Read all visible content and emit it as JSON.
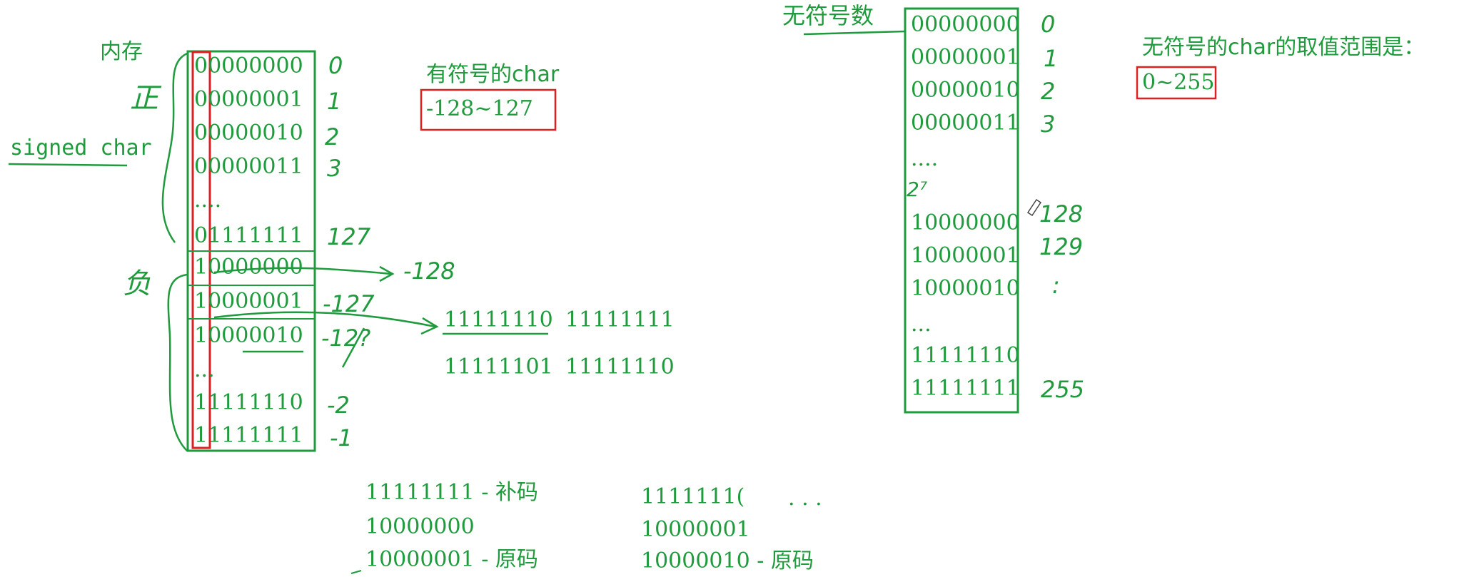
{
  "left_panel": {
    "memory_label": "内存",
    "signed_char_label": "signed char",
    "positive_mark": "正",
    "negative_mark": "负",
    "rows": [
      {
        "bits": "00000000",
        "value": "0"
      },
      {
        "bits": "00000001",
        "value": "1"
      },
      {
        "bits": "00000010",
        "value": "2"
      },
      {
        "bits": "00000011",
        "value": "3"
      },
      {
        "bits": "....",
        "value": ""
      },
      {
        "bits": "01111111",
        "value": "127"
      },
      {
        "bits": "10000000",
        "value": "-128"
      },
      {
        "bits": "10000001",
        "value": "-127"
      },
      {
        "bits": "10000010",
        "value": "-12?"
      },
      {
        "bits": "...",
        "value": ""
      },
      {
        "bits": "11111110",
        "value": "-2"
      },
      {
        "bits": "11111111",
        "value": "-1"
      }
    ],
    "signed_title": "有符号的char",
    "signed_range": "-128~127",
    "calc_row1": [
      "11111110",
      "11111111"
    ],
    "calc_row2": [
      "11111101",
      "11111110"
    ]
  },
  "bottom_notes": {
    "col1": [
      "11111111 - 补码",
      "10000000",
      "10000001 - 原码"
    ],
    "col2": [
      "1111111(",
      "10000001",
      "10000010 - 原码"
    ],
    "dots": ". .   ."
  },
  "right_panel": {
    "unsigned_label": "无符号数",
    "rows": [
      {
        "bits": "00000000",
        "value": "0"
      },
      {
        "bits": "00000001",
        "value": "1"
      },
      {
        "bits": "00000010",
        "value": "2"
      },
      {
        "bits": "00000011",
        "value": "3"
      },
      {
        "bits": "....",
        "value": ""
      },
      {
        "bits": "10000000",
        "value": "128"
      },
      {
        "bits": "10000001",
        "value": "129"
      },
      {
        "bits": "10000010",
        "value": ":"
      },
      {
        "bits": "...",
        "value": ""
      },
      {
        "bits": "11111110",
        "value": ""
      },
      {
        "bits": "11111111",
        "value": "255"
      }
    ],
    "power_mark": "2⁷",
    "unsigned_title": "无符号的char的取值范围是：",
    "unsigned_range": "0~255"
  },
  "colors": {
    "ink": "#1f9a3c",
    "highlight": "#e02020",
    "background": "#ffffff"
  }
}
